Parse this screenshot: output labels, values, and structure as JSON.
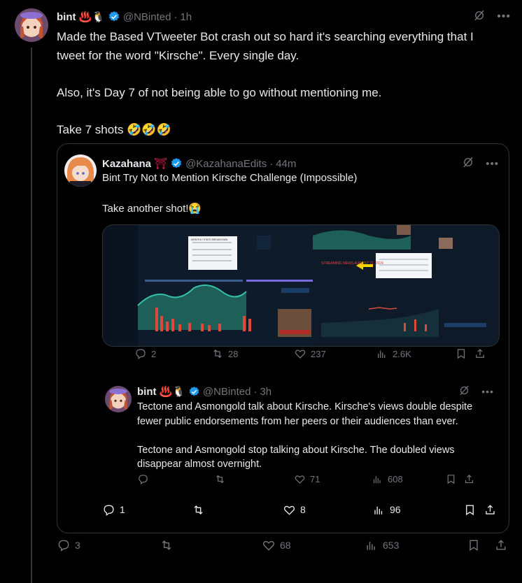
{
  "main": {
    "name": "bint",
    "emojis": "♨️🐧",
    "handle": "@NBinted",
    "time": "1h",
    "text": "Made the Based VTweeter Bot crash out so hard it's searching everything that I tweet for the word \"Kirsche\". Every single day.\n\nAlso, it's Day 7 of not being able to go without mentioning me.\n\nTake 7 shots 🤣🤣🤣",
    "stats": {
      "replies": "3",
      "retweets": "",
      "likes": "68",
      "views": "653"
    }
  },
  "quote": {
    "name": "Kazahana",
    "emoji": "⛩",
    "handle": "@KazahanaEdits",
    "time": "44m",
    "text": "Bint Try Not to Mention Kirsche Challenge (Impossible)\n\nTake another shot!😭",
    "image_stats": {
      "replies": "2",
      "retweets": "28",
      "likes": "237",
      "views": "2.6K"
    },
    "stats": {
      "replies": "1",
      "retweets": "",
      "likes": "8",
      "views": "96"
    }
  },
  "nested": {
    "name": "bint",
    "emojis": "♨️🐧",
    "handle": "@NBinted",
    "time": "3h",
    "text": "Tectone and Asmongold talk about Kirsche. Kirsche's views double despite fewer public endorsements from her peers or their audiences than ever.\n\nTectone and Asmongold stop talking about Kirsche. The doubled views disappear almost overnight.",
    "stats": {
      "replies": "",
      "retweets": "",
      "likes": "71",
      "views": "608"
    }
  },
  "image_labels": {
    "breakdown_title": "MONTHLY STATS BREAKDOWN",
    "streaming_title": "STREAMING NEWS AUGUST 21, 2024"
  },
  "colors": {
    "accent": "#1d9bf0",
    "muted": "#71767b",
    "border": "#2f3336"
  }
}
